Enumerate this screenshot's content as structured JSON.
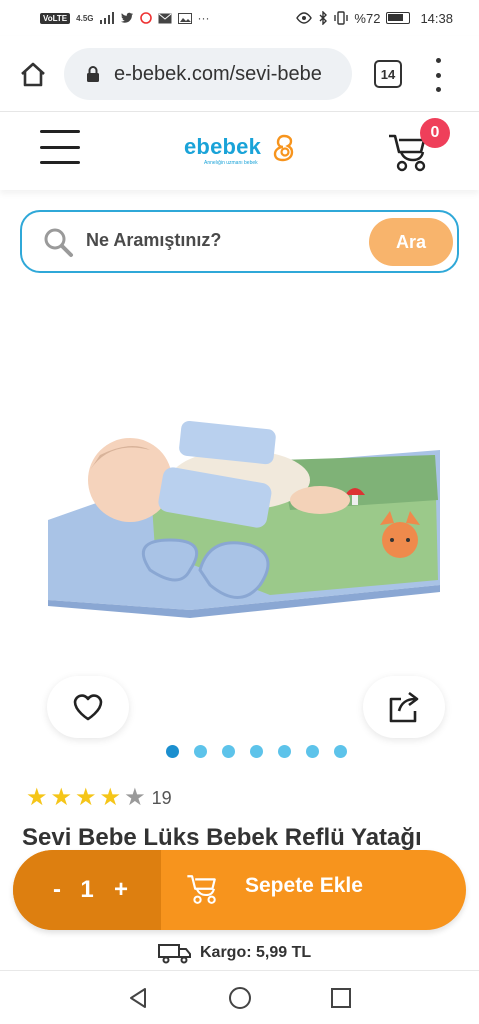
{
  "status_bar": {
    "left_chips": [
      "VoLTE",
      "4.5G"
    ],
    "right_text": "%72",
    "time": "14:38"
  },
  "browser": {
    "url": "e-bebek.com/sevi-bebe",
    "tab_count": "14"
  },
  "site_header": {
    "logo_text": "ebebek",
    "logo_tagline": "Annelığin uzmanı bebek",
    "cart_count": "0"
  },
  "search": {
    "placeholder": "Ne Aramıştınız?",
    "button_label": "Ara"
  },
  "gallery": {
    "dot_count": 7,
    "active_index": 0
  },
  "rating": {
    "stars_filled": 4,
    "stars_total": 5,
    "review_count": "19"
  },
  "product": {
    "title": "Sevi Bebe Lüks Bebek Reflü Yatağı"
  },
  "cart_bar": {
    "minus_label": "-",
    "quantity": "1",
    "plus_label": "+",
    "add_label": "Sepete Ekle"
  },
  "shipping": {
    "text": "Kargo: 5,99 TL"
  },
  "colors": {
    "brand_blue": "#1aa3d8",
    "search_border": "#2fa8d8",
    "search_button": "#f8b46c",
    "cart_bar_orange": "#f7941d",
    "qty_orange": "#dd7f10",
    "badge_red": "#ef3f5a",
    "star_yellow": "#f5c518",
    "star_grey": "#9a9a9a",
    "dot_active": "#1b8fcf",
    "dot_inactive": "#5dc3ea"
  },
  "icons": {
    "home": "home-icon",
    "lock": "lock-icon",
    "search": "search-icon",
    "cart": "stroller-cart-icon",
    "favorite": "heart-icon",
    "share": "share-icon",
    "truck": "truck-icon"
  }
}
